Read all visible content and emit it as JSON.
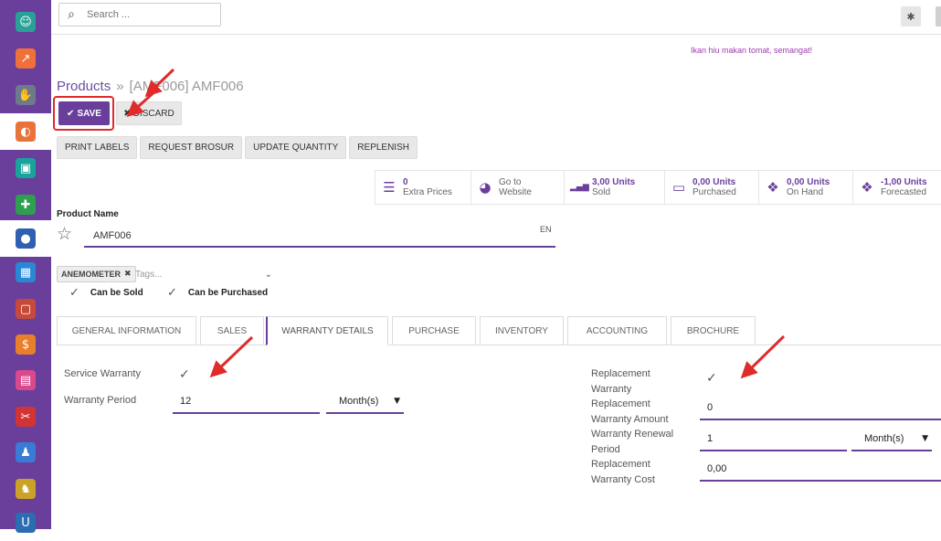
{
  "sidebar": {
    "items": [
      {
        "icon": "contacts-icon",
        "glyph": "☺",
        "color": "#2aa198"
      },
      {
        "icon": "chart-icon",
        "glyph": "↗",
        "color": "#f0703a"
      },
      {
        "icon": "handshake-icon",
        "glyph": "✋",
        "color": "#6c7a8a"
      },
      {
        "icon": "website-icon",
        "glyph": "◐",
        "color": "#e8743b",
        "active": true
      },
      {
        "icon": "presentation-icon",
        "glyph": "▣",
        "color": "#1aa39a"
      },
      {
        "icon": "puzzle-icon",
        "glyph": "✚",
        "color": "#2e9e4f"
      },
      {
        "icon": "badge-icon",
        "glyph": "●",
        "color": "#2f5fb0",
        "active": true
      },
      {
        "icon": "boxes-icon",
        "glyph": "▦",
        "color": "#2a87d4"
      },
      {
        "icon": "note-icon",
        "glyph": "▢",
        "color": "#c64a3a"
      },
      {
        "icon": "invoice-icon",
        "glyph": "$",
        "color": "#e87f2a"
      },
      {
        "icon": "pos-icon",
        "glyph": "▤",
        "color": "#d94a8c"
      },
      {
        "icon": "pdf-icon",
        "glyph": "✂",
        "color": "#d13434"
      },
      {
        "icon": "user-clock-icon",
        "glyph": "♟",
        "color": "#3a7bd5"
      },
      {
        "icon": "user-settings-icon",
        "glyph": "♞",
        "color": "#c9a227"
      },
      {
        "icon": "u-icon",
        "glyph": "U",
        "color": "#2c6cb0"
      }
    ]
  },
  "topbar": {
    "search_placeholder": "Search ...",
    "motto": "Ikan hiu makan tomat, semangat!"
  },
  "breadcrumb": {
    "parent": "Products",
    "separator": "»",
    "current": "[AMF006] AMF006"
  },
  "buttons": {
    "save": "SAVE",
    "discard": "DISCARD"
  },
  "actions": [
    "PRINT LABELS",
    "REQUEST BROSUR",
    "UPDATE QUANTITY",
    "REPLENISH"
  ],
  "stats": [
    {
      "icon": "list-icon",
      "glyph": "☰",
      "value": "0",
      "label": "Extra Prices"
    },
    {
      "icon": "globe-icon",
      "glyph": "◕",
      "value": "Go to",
      "label": "Website",
      "plain": true
    },
    {
      "icon": "bar-chart-icon",
      "glyph": "▂▄▆",
      "value": "3,00 Units",
      "label": "Sold"
    },
    {
      "icon": "credit-card-icon",
      "glyph": "▭",
      "value": "0,00 Units",
      "label": "Purchased"
    },
    {
      "icon": "cubes-icon",
      "glyph": "❖",
      "value": "0,00 Units",
      "label": "On Hand"
    },
    {
      "icon": "cubes-forecast-icon",
      "glyph": "❖",
      "value": "-1,00 Units",
      "label": "Forecasted"
    }
  ],
  "product": {
    "name_label": "Product Name",
    "name_value": "AMF006",
    "lang": "EN",
    "tag": "ANEMOMETER",
    "tags_placeholder": "Tags...",
    "can_be_sold": "Can be Sold",
    "can_be_purchased": "Can be Purchased"
  },
  "tabs": [
    {
      "label": "GENERAL INFORMATION"
    },
    {
      "label": "SALES"
    },
    {
      "label": "WARRANTY DETAILS",
      "active": true
    },
    {
      "label": "PURCHASE"
    },
    {
      "label": "INVENTORY"
    },
    {
      "label": "ACCOUNTING"
    },
    {
      "label": "BROCHURE"
    }
  ],
  "warranty": {
    "service_warranty_label": "Service Warranty",
    "warranty_period_label": "Warranty Period",
    "warranty_period_value": "12",
    "warranty_period_unit": "Month(s)",
    "replacement_warranty_label": "Replacement Warranty",
    "replacement_amount_label": "Replacement Warranty Amount",
    "replacement_amount_value": "0",
    "renewal_period_label": "Warranty Renewal Period",
    "renewal_period_value": "1",
    "renewal_period_unit": "Month(s)",
    "replacement_cost_label": "Replacement Warranty Cost",
    "replacement_cost_value": "0,00"
  },
  "colors": {
    "brand": "#6a3f9b",
    "annotation": "#e02b2b"
  }
}
